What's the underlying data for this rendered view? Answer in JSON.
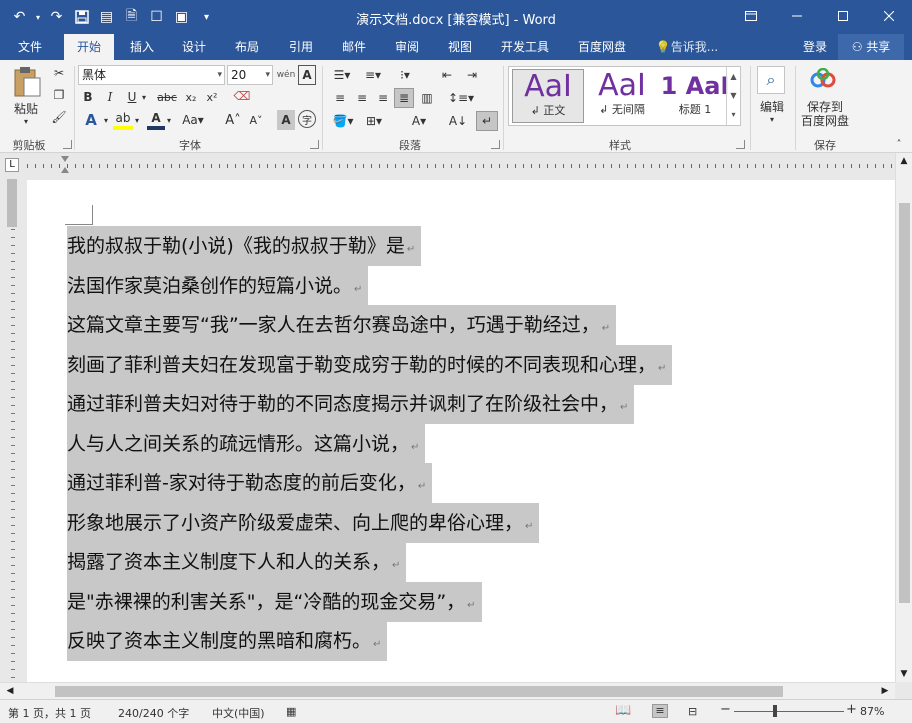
{
  "window": {
    "title": "演示文档.docx [兼容模式] - Word"
  },
  "tabs": [
    "文件",
    "开始",
    "插入",
    "设计",
    "布局",
    "引用",
    "邮件",
    "审阅",
    "视图",
    "开发工具",
    "百度网盘"
  ],
  "tell_me": "告诉我...",
  "signin": "登录",
  "share": "共享",
  "ribbon": {
    "clipboard": {
      "label": "剪贴板",
      "paste": "粘贴"
    },
    "font": {
      "label": "字体",
      "name": "黑体",
      "size": "20"
    },
    "paragraph": {
      "label": "段落"
    },
    "styles": {
      "label": "样式",
      "items": [
        {
          "sample": "AaI",
          "name": "正文"
        },
        {
          "sample": "AaI",
          "name": "无间隔"
        },
        {
          "sample": "1 AaI",
          "name": "标题 1"
        }
      ]
    },
    "editing": {
      "label": "编辑"
    },
    "save": {
      "label": "保存",
      "button": "保存到\n百度网盘",
      "line1": "保存到",
      "line2": "百度网盘"
    }
  },
  "document": {
    "lines": [
      "我的叔叔于勒(小说)《我的叔叔于勒》是",
      "法国作家莫泊桑创作的短篇小说。",
      "这篇文章主要写“我”一家人在去哲尔赛岛途中，巧遇于勒经过，",
      "刻画了菲利普夫妇在发现富于勒变成穷于勒的时候的不同表现和心理，",
      "通过菲利普夫妇对待于勒的不同态度揭示并讽刺了在阶级社会中，",
      "人与人之间关系的疏远情形。这篇小说，",
      "通过菲利普-家对待于勒态度的前后变化，",
      "形象地展示了小资产阶级爱虚荣、向上爬的卑俗心理，",
      "揭露了资本主义制度下人和人的关系，",
      "是\"赤裸裸的利害关系\"，是“冷酷的现金交易”，",
      "反映了资本主义制度的黑暗和腐朽。"
    ]
  },
  "status": {
    "page": "第 1 页，共 1 页",
    "words": "240/240 个字",
    "language": "中文(中国)",
    "zoom": "87%"
  },
  "colors": {
    "accent": "#2b579a",
    "selection": "#c8c8c8",
    "style_sample": "#7030a0"
  }
}
